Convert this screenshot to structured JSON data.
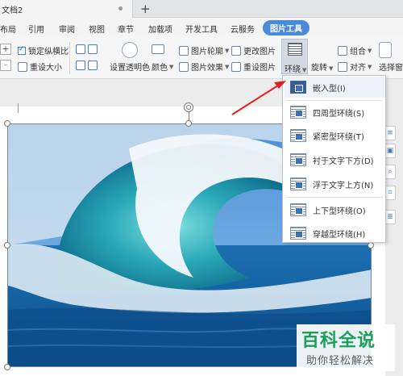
{
  "tabbar": {
    "doc_title": "文档2",
    "new_tab": "+"
  },
  "menu": {
    "items": [
      "布局",
      "引用",
      "审阅",
      "视图",
      "章节",
      "加载项",
      "开发工具",
      "云服务",
      "图片工具"
    ],
    "active": "图片工具"
  },
  "ribbon": {
    "lock_ratio": "锁定纵横比",
    "reset_size": "重设大小",
    "set_transparent": "设置透明色",
    "color": "颜色",
    "outline": "图片轮廓",
    "effects": "图片效果",
    "change_image": "更改图片",
    "reset_image": "重设图片",
    "wrap": "环绕",
    "rotate": "旋转",
    "group": "组合",
    "align": "对齐",
    "selection_pane": "选择窗格",
    "plus": "+"
  },
  "wrap_menu": {
    "items": [
      {
        "label": "嵌入型(I)",
        "icon": "inline-wrap-icon"
      },
      {
        "label": "四周型环绕(S)",
        "icon": "square-wrap-icon"
      },
      {
        "label": "紧密型环绕(T)",
        "icon": "tight-wrap-icon"
      },
      {
        "label": "衬于文字下方(D)",
        "icon": "behind-text-icon"
      },
      {
        "label": "浮于文字上方(N)",
        "icon": "in-front-text-icon"
      },
      {
        "label": "上下型环绕(O)",
        "icon": "top-bottom-wrap-icon"
      },
      {
        "label": "穿越型环绕(H)",
        "icon": "through-wrap-icon"
      }
    ]
  },
  "watermark": {
    "title": "百科全说",
    "subtitle": "助你轻松解决"
  },
  "colors": {
    "accent": "#4a8bd9",
    "arrow": "#e02020",
    "watermark_green": "#1aa05a"
  }
}
